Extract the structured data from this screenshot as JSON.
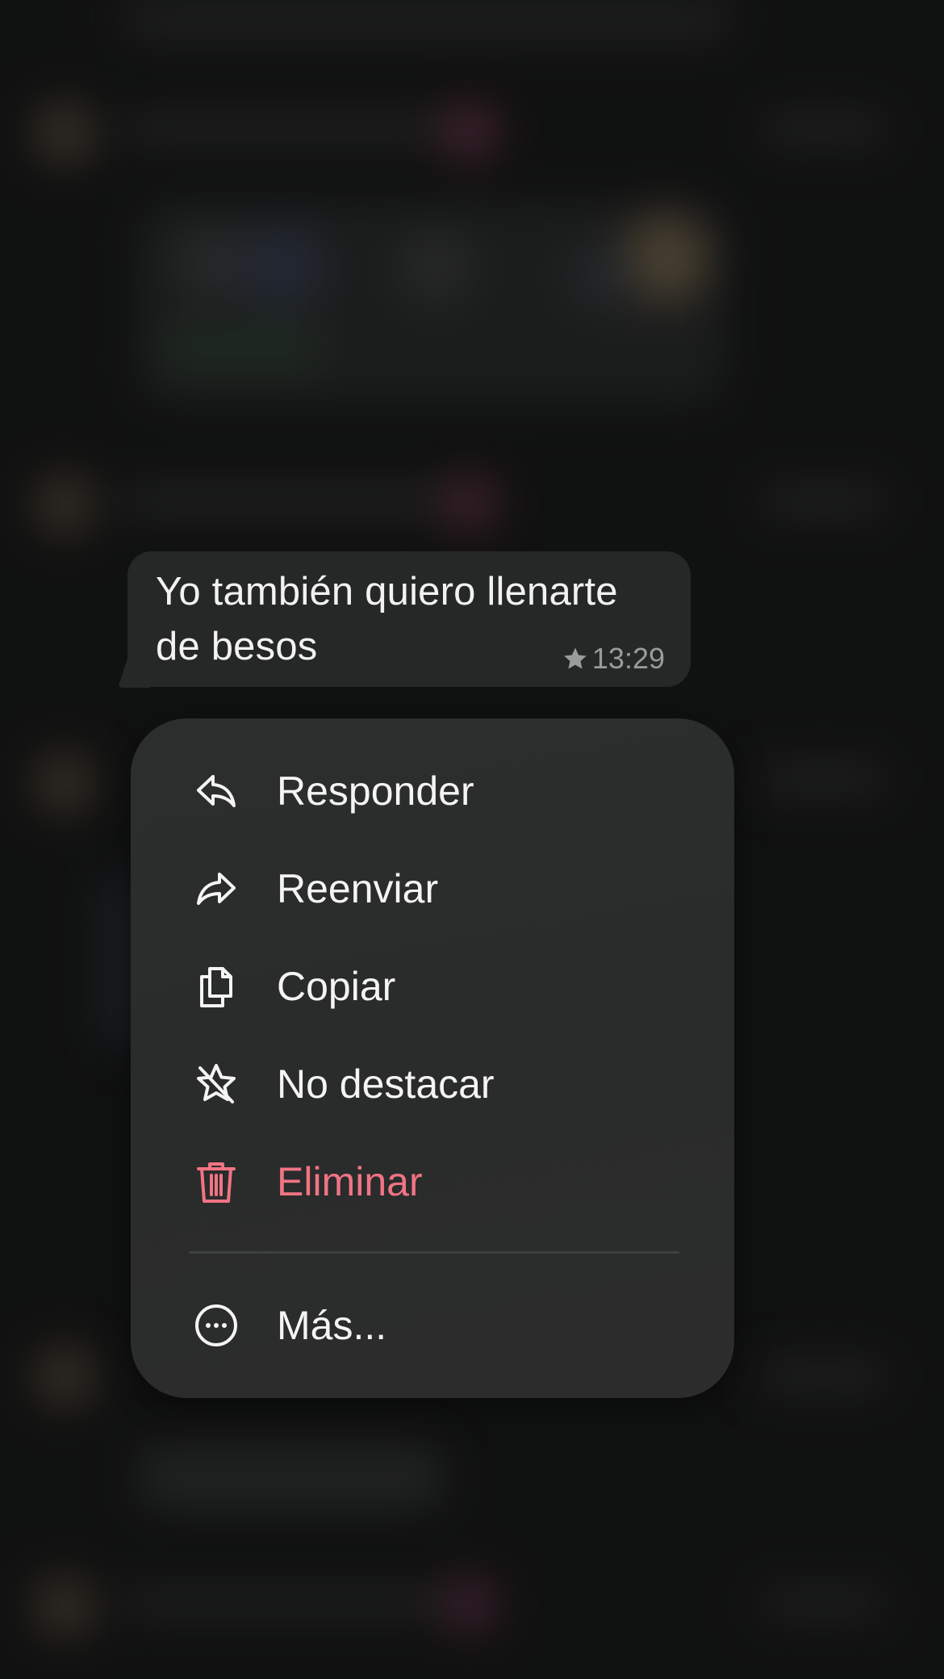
{
  "message": {
    "text": "Yo también quiero llenarte de besos",
    "time": "13:29",
    "starred_icon": "star-icon"
  },
  "menu": {
    "items": [
      {
        "label": "Responder",
        "icon": "reply-icon"
      },
      {
        "label": "Reenviar",
        "icon": "forward-icon"
      },
      {
        "label": "Copiar",
        "icon": "copy-icon"
      },
      {
        "label": "No destacar",
        "icon": "unstar-icon"
      },
      {
        "label": "Eliminar",
        "icon": "trash-icon"
      },
      {
        "label": "Más...",
        "icon": "more-icon"
      }
    ]
  },
  "colors": {
    "background": "#151616",
    "bubble": "#262828",
    "menu": "#2b2c2c",
    "text": "#f4f4f4",
    "danger": "#f07484",
    "meta": "#9a9c9c"
  }
}
